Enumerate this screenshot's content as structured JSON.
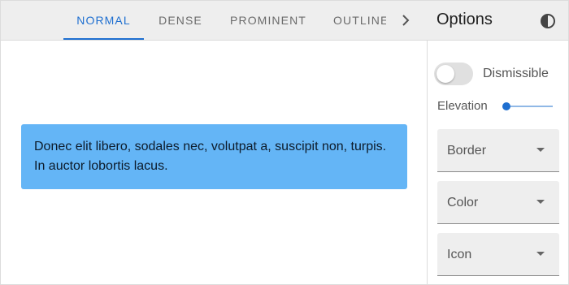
{
  "tabs": [
    {
      "label": "NORMAL",
      "active": true
    },
    {
      "label": "DENSE",
      "active": false
    },
    {
      "label": "PROMINENT",
      "active": false
    },
    {
      "label": "OUTLINED",
      "active": false
    }
  ],
  "options": {
    "title": "Options",
    "contrast_icon": "contrast-icon",
    "dismissible": {
      "label": "Dismissible",
      "on": false
    },
    "elevation": {
      "label": "Elevation",
      "value": 0
    },
    "selects": [
      {
        "label": "Border",
        "value": ""
      },
      {
        "label": "Color",
        "value": ""
      },
      {
        "label": "Icon",
        "value": ""
      }
    ]
  },
  "banner": {
    "text": "Donec elit libero, sodales nec, volutpat a, suscipit non, turpis. In auctor lobortis lacus.",
    "color": "#64b5f6"
  },
  "colors": {
    "accent": "#1e6fd0",
    "topbar": "#eeeeee"
  }
}
